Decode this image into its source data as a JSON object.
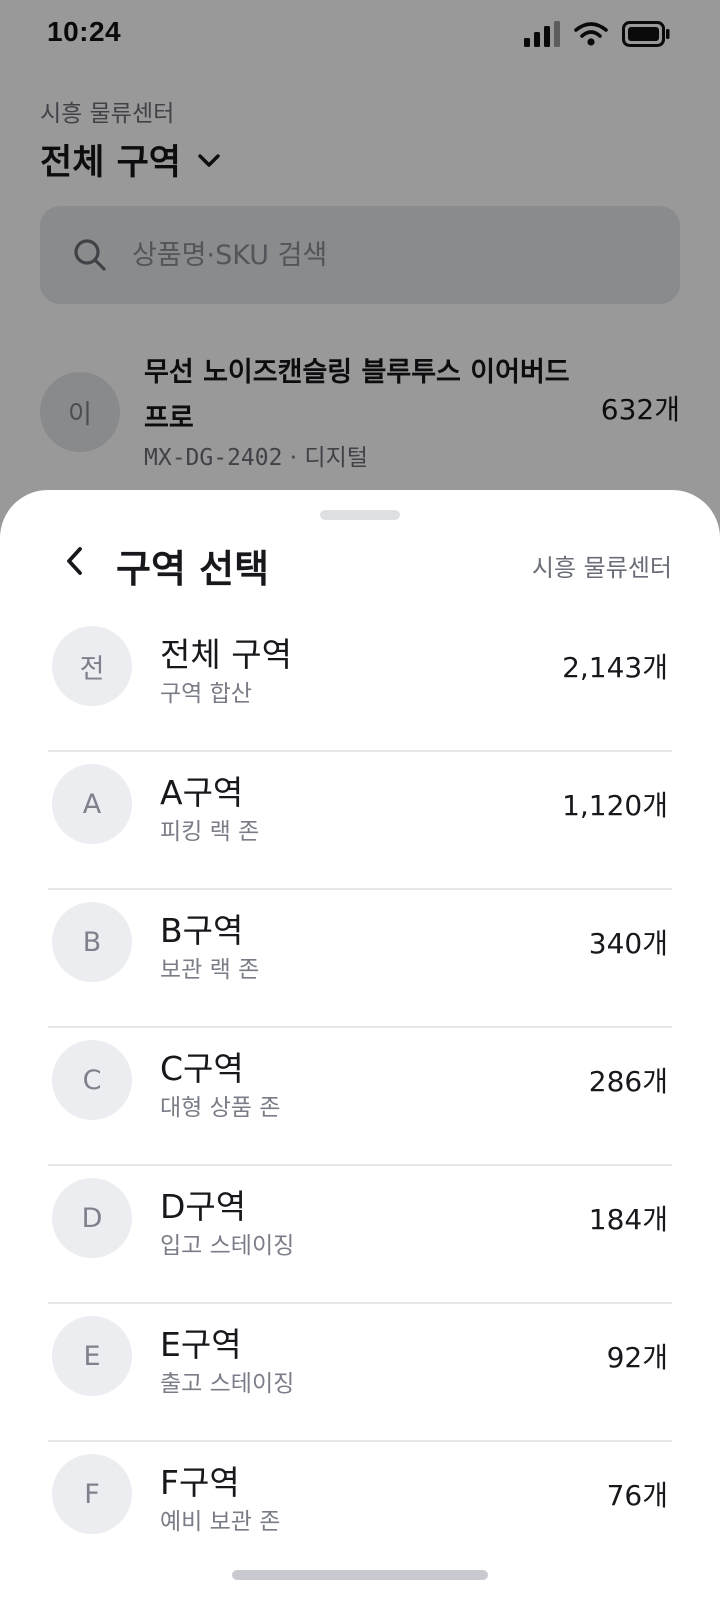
{
  "status_bar": {
    "time": "10:24",
    "icons": [
      "signal-icon",
      "wifi-icon",
      "battery-icon"
    ]
  },
  "page": {
    "subtitle": "시흥 물류센터",
    "title": "전체 구역",
    "title_icon": "chevron-down-icon",
    "search": {
      "placeholder": "상품명·SKU 검색",
      "value": "",
      "icon": "search-icon"
    },
    "items": [
      {
        "avatar": "이",
        "name": "무선 노이즈캔슬링 블루투스 이어버드 프로",
        "sku": "MX-DG-2402",
        "separator": "·",
        "category": "디지털",
        "count": "632개"
      }
    ]
  },
  "sheet": {
    "title": "구역 선택",
    "context": "시흥 물류센터",
    "back_icon": "chevron-left-icon",
    "zones": [
      {
        "avatar": "전",
        "name": "전체 구역",
        "desc": "구역 합산",
        "count": "2,143개"
      },
      {
        "avatar": "A",
        "name": "A구역",
        "desc": "피킹 랙 존",
        "count": "1,120개"
      },
      {
        "avatar": "B",
        "name": "B구역",
        "desc": "보관 랙 존",
        "count": "340개"
      },
      {
        "avatar": "C",
        "name": "C구역",
        "desc": "대형 상품 존",
        "count": "286개"
      },
      {
        "avatar": "D",
        "name": "D구역",
        "desc": "입고 스테이징",
        "count": "184개"
      },
      {
        "avatar": "E",
        "name": "E구역",
        "desc": "출고 스테이징",
        "count": "92개"
      },
      {
        "avatar": "F",
        "name": "F구역",
        "desc": "예비 보관 존",
        "count": "76개"
      }
    ]
  },
  "colors": {
    "scrim": "#000000",
    "sheet_background": "#ffffff",
    "avatar_background": "#ecedf1",
    "divider": "#e6e7ea",
    "text_primary": "#17171c",
    "text_secondary": "#7a7d87"
  }
}
